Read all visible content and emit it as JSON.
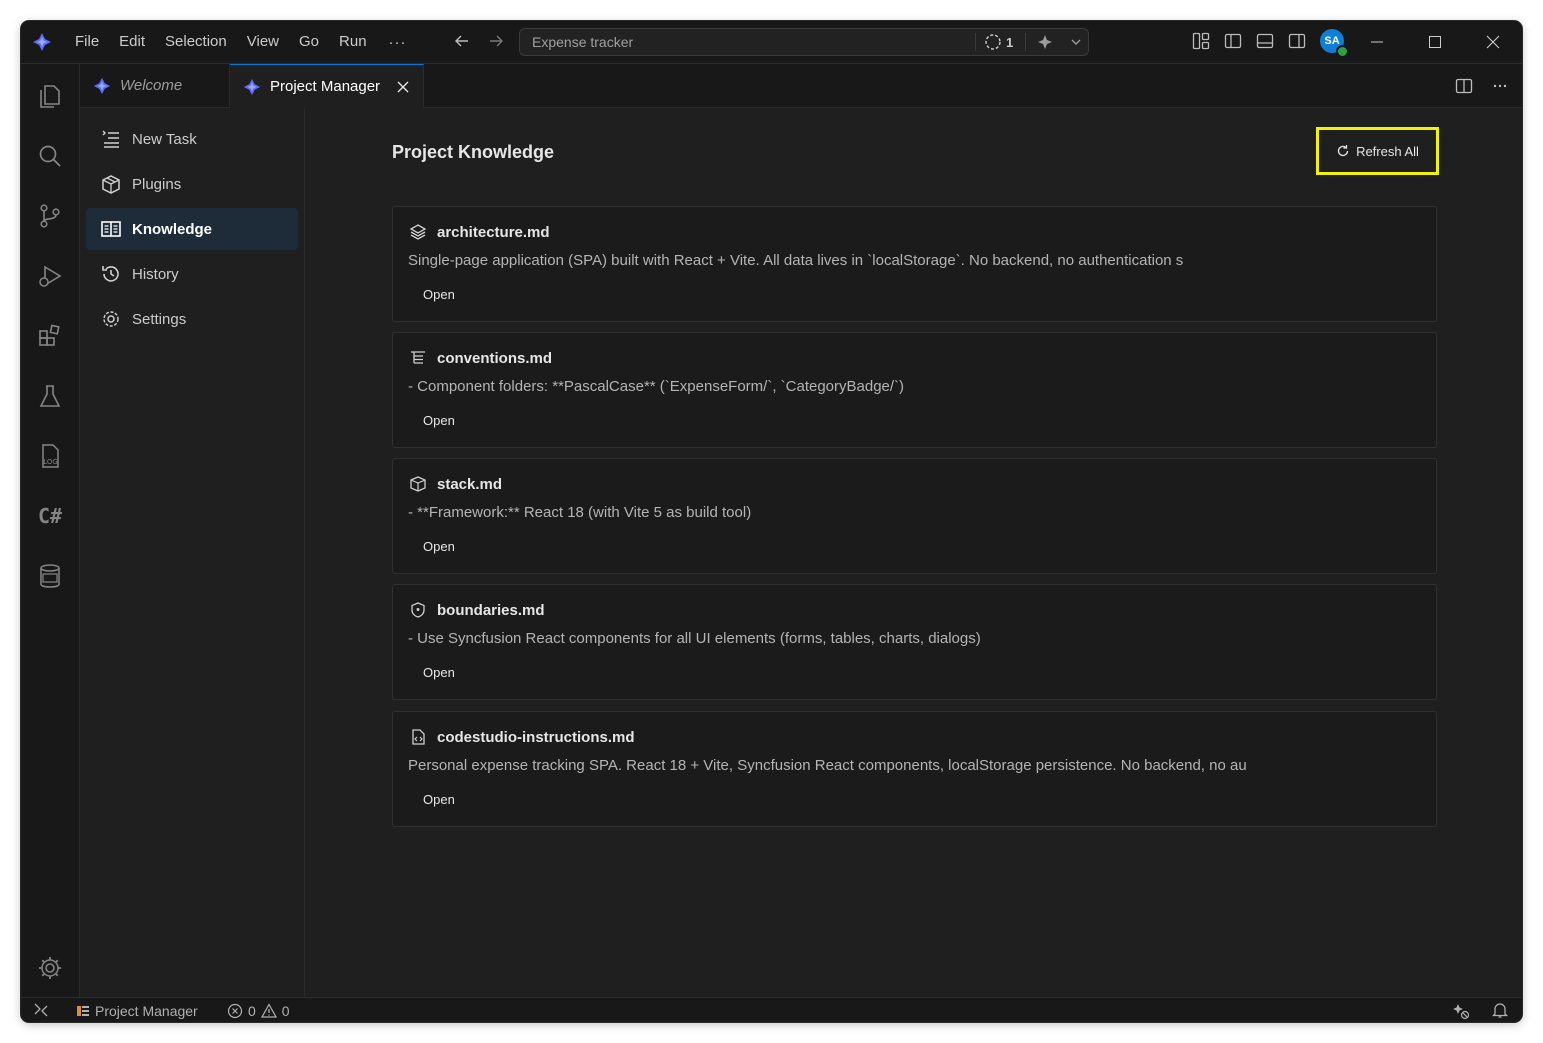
{
  "menu": {
    "items": [
      "File",
      "Edit",
      "Selection",
      "View",
      "Go",
      "Run"
    ],
    "more": "···"
  },
  "command_center": {
    "title": "Expense tracker",
    "progress_count": "1"
  },
  "account": {
    "initials": "SA"
  },
  "tabs": [
    {
      "label": "Welcome",
      "active": false
    },
    {
      "label": "Project Manager",
      "active": true
    }
  ],
  "sidebar": {
    "items": [
      {
        "label": "New Task",
        "icon": "new-task-icon",
        "active": false
      },
      {
        "label": "Plugins",
        "icon": "box-icon",
        "active": false
      },
      {
        "label": "Knowledge",
        "icon": "book-icon",
        "active": true
      },
      {
        "label": "History",
        "icon": "history-icon",
        "active": false
      },
      {
        "label": "Settings",
        "icon": "gear-icon",
        "active": false
      }
    ]
  },
  "activity_bar": {
    "csharp_label": "C#",
    "log_label": "LOG"
  },
  "main": {
    "title": "Project Knowledge",
    "refresh_label": "Refresh All",
    "cards": [
      {
        "title": "architecture.md",
        "icon": "layers-icon",
        "description": "Single-page application (SPA) built with React + Vite. All data lives in `localStorage`. No backend, no authentication s",
        "action": "Open"
      },
      {
        "title": "conventions.md",
        "icon": "list-tree-icon",
        "description": "- Component folders: **PascalCase** (`ExpenseForm/`, `CategoryBadge/`)",
        "action": "Open"
      },
      {
        "title": "stack.md",
        "icon": "package-icon",
        "description": "- **Framework:** React 18 (with Vite 5 as build tool)",
        "action": "Open"
      },
      {
        "title": "boundaries.md",
        "icon": "shield-icon",
        "description": "- Use Syncfusion React components for all UI elements (forms, tables, charts, dialogs)",
        "action": "Open"
      },
      {
        "title": "codestudio-instructions.md",
        "icon": "code-file-icon",
        "description": "Personal expense tracking SPA. React 18 + Vite, Syncfusion React components, localStorage persistence. No backend, no au",
        "action": "Open"
      }
    ]
  },
  "status_bar": {
    "project": "Project Manager",
    "errors": "0",
    "warnings": "0"
  },
  "colors": {
    "accent": "#0078d4",
    "highlight_box": "#f3f300",
    "active_nav": "#1e2b38"
  }
}
